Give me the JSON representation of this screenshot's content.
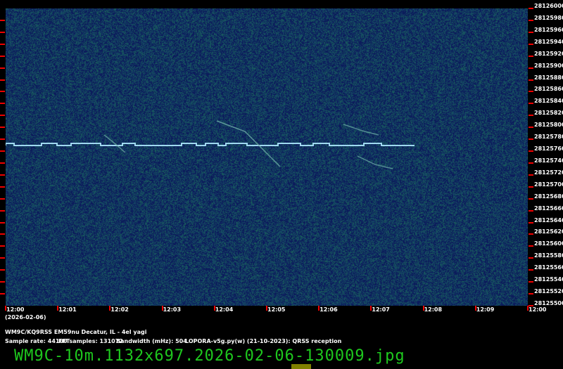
{
  "freq_labels": [
    "28126000",
    "28125980",
    "28125960",
    "28125940",
    "28125920",
    "28125900",
    "28125880",
    "28125860",
    "28125840",
    "28125820",
    "28125800",
    "28125780",
    "28125760",
    "28125740",
    "28125720",
    "28125700",
    "28125680",
    "28125660",
    "28125640",
    "28125620",
    "28125600",
    "28125580",
    "28125560",
    "28125540",
    "28125520",
    "28125500"
  ],
  "time_labels": [
    "12:00",
    "12:01",
    "12:02",
    "12:03",
    "12:04",
    "12:05",
    "12:06",
    "12:07",
    "12:08",
    "12:09",
    "12:00"
  ],
  "date_label": "(2026-02-06)",
  "station": "WM9C/KQ9RSS EM59nu Decatur, IL - 4el yagi",
  "sample_rate": "Sample rate: 44100",
  "fft_samples": "FFTsamples: 131072",
  "bandwidth": "Bandwidth (mHz): 504",
  "software": "LOPORA-v5g.py(w) (21-10-2023): QRSS reception",
  "filename": "WM9C-10m.1132x697.2026-02-06-130009.jpg",
  "colors": {
    "background": "#0c1c5c",
    "signal": "#9fd8f0",
    "tick": "#e00000",
    "filename": "#1ec81e"
  }
}
